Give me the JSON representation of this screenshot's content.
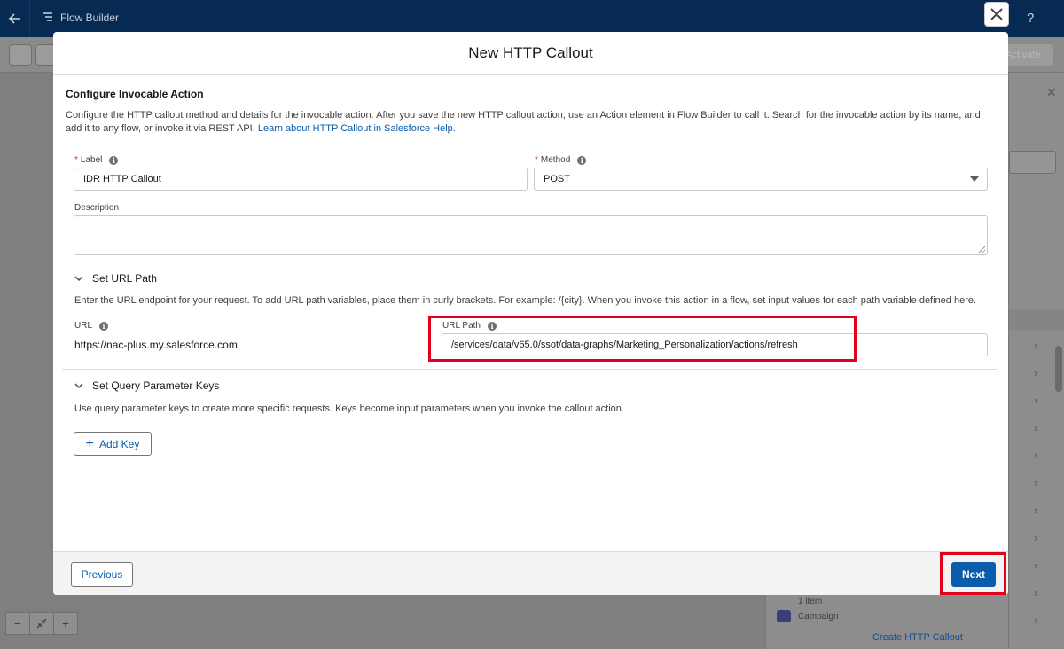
{
  "app": {
    "name": "Flow Builder",
    "activate_label": "Activate",
    "help_label": "?"
  },
  "modal": {
    "title": "New HTTP Callout",
    "section": {
      "title": "Configure Invocable Action",
      "description": "Configure the HTTP callout method and details for the invocable action. After you save the new HTTP callout action, use an Action element in Flow Builder to call it. Search for the invocable action by its name, and add it to any flow, or invoke it via REST API.",
      "help_link": "Learn about HTTP Callout in Salesforce Help."
    },
    "label_field": {
      "label": "Label",
      "required_mark": "*",
      "value": "IDR HTTP Callout"
    },
    "method_field": {
      "label": "Method",
      "required_mark": "*",
      "value": "POST"
    },
    "description_field": {
      "label": "Description",
      "value": ""
    },
    "url_section": {
      "title": "Set URL Path",
      "description": "Enter the URL endpoint for your request. To add URL path variables, place them in curly brackets. For example: /{city}. When you invoke this action in a flow, set input values for each path variable defined here.",
      "url_label": "URL",
      "url_value": "https://nac-plus.my.salesforce.com",
      "path_label": "URL Path",
      "path_value": "/services/data/v65.0/ssot/data-graphs/Marketing_Personalization/actions/refresh"
    },
    "query_section": {
      "title": "Set Query Parameter Keys",
      "description": "Use query parameter keys to create more specific requests. Keys become input parameters when you invoke the callout action.",
      "add_key_label": "Add Key"
    },
    "footer": {
      "previous_label": "Previous",
      "next_label": "Next"
    }
  },
  "background_panel": {
    "item_count": "1 item",
    "item_name": "Campaign",
    "create_link": "Create HTTP Callout"
  },
  "colors": {
    "brand": "#0b5cab",
    "highlight": "#e0001b",
    "header": "#062a52"
  }
}
